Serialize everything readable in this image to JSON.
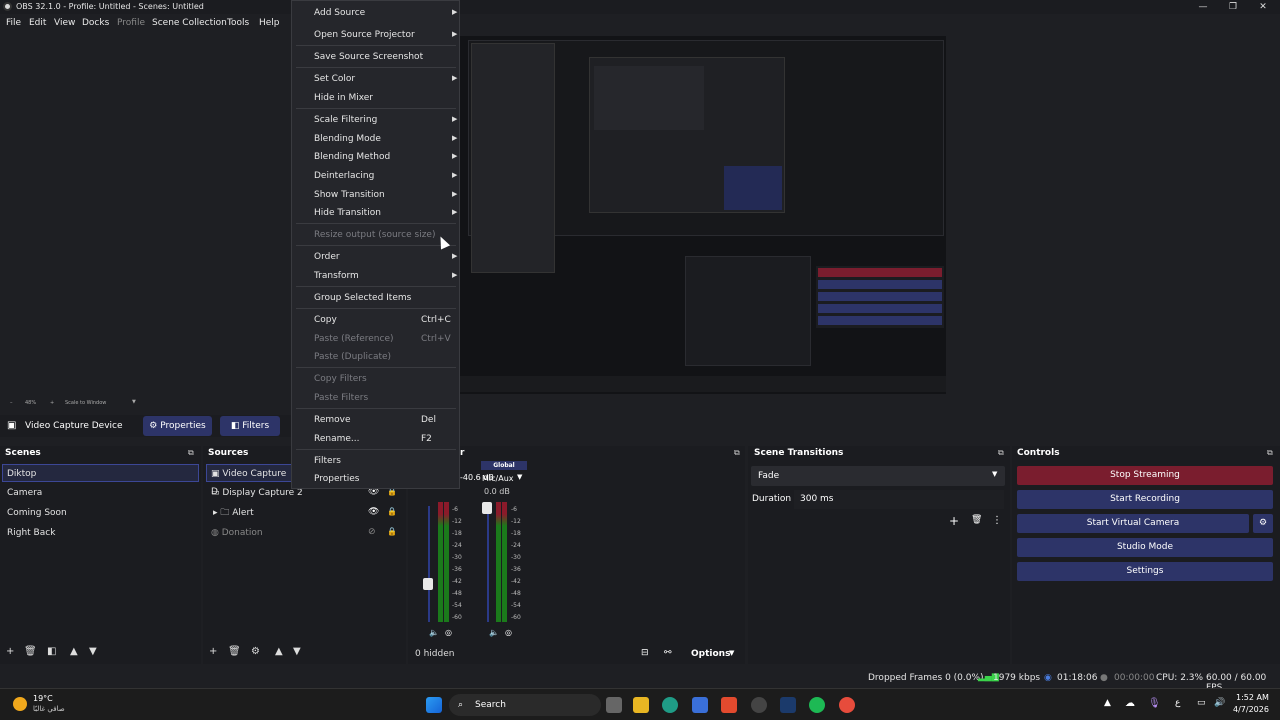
{
  "window": {
    "title": "OBS 32.1.0 - Profile: Untitled - Scenes: Untitled"
  },
  "menubar": {
    "items": [
      "File",
      "Edit",
      "View",
      "Docks",
      "Profile",
      "Scene Collection",
      "Tools",
      "Help"
    ]
  },
  "context_menu": {
    "items": [
      {
        "label": "Add Source",
        "submenu": true
      },
      {
        "label": "Open Source Projector",
        "submenu": true
      },
      {
        "label": "Save Source Screenshot"
      },
      {
        "label": "Set Color",
        "submenu": true
      },
      {
        "label": "Hide in Mixer"
      },
      {
        "label": "Scale Filtering",
        "submenu": true
      },
      {
        "label": "Blending Mode",
        "submenu": true
      },
      {
        "label": "Blending Method",
        "submenu": true
      },
      {
        "label": "Deinterlacing",
        "submenu": true
      },
      {
        "label": "Show Transition",
        "submenu": true
      },
      {
        "label": "Hide Transition",
        "submenu": true
      },
      {
        "label": "Resize output (source size)",
        "disabled": true
      },
      {
        "label": "Order",
        "submenu": true
      },
      {
        "label": "Transform",
        "submenu": true
      },
      {
        "label": "Group Selected Items"
      },
      {
        "label": "Copy",
        "shortcut": "Ctrl+C"
      },
      {
        "label": "Paste (Reference)",
        "shortcut": "Ctrl+V",
        "disabled": true
      },
      {
        "label": "Paste (Duplicate)",
        "disabled": true
      },
      {
        "label": "Copy Filters",
        "disabled": true
      },
      {
        "label": "Paste Filters",
        "disabled": true
      },
      {
        "label": "Remove",
        "shortcut": "Del"
      },
      {
        "label": "Rename...",
        "shortcut": "F2"
      },
      {
        "label": "Filters"
      },
      {
        "label": "Properties"
      }
    ]
  },
  "preview": {
    "zoom": "48%",
    "scale_label": "Scale to Window"
  },
  "source_toolbar": {
    "source_name": "Video Capture Device",
    "properties": "Properties",
    "filters": "Filters"
  },
  "scenes": {
    "title": "Scenes",
    "items": [
      "Diktop",
      "Camera",
      "Coming Soon",
      "Right Back"
    ],
    "selected": 0
  },
  "sources": {
    "title": "Sources",
    "items": [
      {
        "name": "Video Capture D",
        "icon": "camera-icon"
      },
      {
        "name": "Display Capture 2",
        "icon": "monitor-icon"
      },
      {
        "name": "Alert",
        "icon": "folder-icon"
      },
      {
        "name": "Donation",
        "icon": "browser-icon"
      }
    ]
  },
  "mixer": {
    "title_fragment": "r",
    "channels": [
      {
        "name": "",
        "db": "-40.6 dB"
      },
      {
        "name": "Mic/Aux",
        "badge": "Global",
        "db": "0.0 dB"
      }
    ],
    "ticks": [
      "-6",
      "-12",
      "-18",
      "-24",
      "-30",
      "-36",
      "-42",
      "-48",
      "-54",
      "-60"
    ],
    "hidden_label": "0 hidden",
    "options_label": "Options"
  },
  "scene_transitions": {
    "title": "Scene Transitions",
    "transition": "Fade",
    "duration_label": "Duration",
    "duration_value": "300 ms"
  },
  "controls": {
    "title": "Controls",
    "buttons": [
      "Stop Streaming",
      "Start Recording",
      "Start Virtual Camera",
      "Studio Mode",
      "Settings"
    ],
    "accent_stop": "#7a1d2e",
    "accent": "#2d3468"
  },
  "status": {
    "dropped": "Dropped Frames 0 (0.0%)",
    "kbps": "1979 kbps",
    "stream_time": "01:18:06",
    "rec_time": "00:00:00",
    "cpu": "CPU: 2.3%",
    "fps": "60.00 / 60.00 FPS"
  },
  "taskbar": {
    "weather_temp": "19°C",
    "weather_desc": "صافي غالبًا",
    "search": "Search",
    "time": "1:52 AM",
    "date": "4/7/2026",
    "lang": "ع"
  }
}
